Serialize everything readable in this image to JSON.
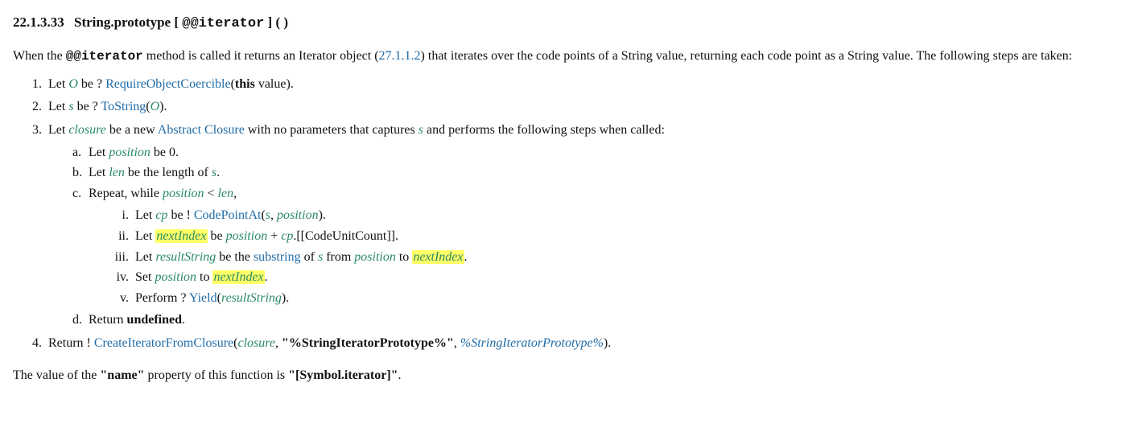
{
  "heading": {
    "number": "22.1.3.33",
    "title_prefix": "String.prototype [ ",
    "title_symbol": "@@iterator",
    "title_suffix": " ] ( )"
  },
  "intro": {
    "pre": "When the ",
    "method": "@@iterator",
    "mid": " method is called it returns an Iterator object (",
    "ref": "27.1.1.2",
    "post": ") that iterates over the code points of a String value, returning each code point as a String value. The following steps are taken:"
  },
  "steps": {
    "s1": {
      "marker": "1.",
      "text_a": "Let ",
      "O": "O",
      "text_b": " be ? ",
      "link": "RequireObjectCoercible",
      "paren_open": "(",
      "this": "this",
      "valueword": " value",
      "paren_close": ")."
    },
    "s2": {
      "marker": "2.",
      "text_a": "Let ",
      "s": "s",
      "text_b": " be ? ",
      "link": "ToString",
      "paren_open": "(",
      "O": "O",
      "paren_close": ")."
    },
    "s3": {
      "marker": "3.",
      "text_a": "Let ",
      "closure": "closure",
      "text_b": " be a new ",
      "link": "Abstract Closure",
      "text_c": " with no parameters that captures ",
      "s": "s",
      "text_d": " and performs the following steps when called:"
    },
    "s3a": {
      "marker": "a.",
      "text_a": "Let ",
      "position": "position",
      "text_b": " be 0."
    },
    "s3b": {
      "marker": "b.",
      "text_a": "Let ",
      "len": "len",
      "text_b": " be the length of ",
      "s": "s",
      "text_c": "."
    },
    "s3c": {
      "marker": "c.",
      "text_a": "Repeat, while ",
      "position": "position",
      "lt": " < ",
      "len": "len",
      "comma": ","
    },
    "s3ci": {
      "marker": "i.",
      "text_a": "Let ",
      "cp": "cp",
      "text_b": " be ! ",
      "link": "CodePointAt",
      "paren_open": "(",
      "s": "s",
      "comma": ", ",
      "position": "position",
      "paren_close": ")."
    },
    "s3cii": {
      "marker": "ii.",
      "text_a": "Let ",
      "nextIndex": "nextIndex",
      "text_b": " be ",
      "position": "position",
      "plus": " + ",
      "cp": "cp",
      "field": ".[[CodeUnitCount]]."
    },
    "s3ciii": {
      "marker": "iii.",
      "text_a": "Let ",
      "resultString": "resultString",
      "text_b": " be the ",
      "link": "substring",
      "text_c": " of ",
      "s": "s",
      "text_d": " from ",
      "position": "position",
      "text_e": " to ",
      "nextIndex": "nextIndex",
      "period": "."
    },
    "s3civ": {
      "marker": "iv.",
      "text_a": "Set ",
      "position": "position",
      "text_b": " to ",
      "nextIndex": "nextIndex",
      "period": "."
    },
    "s3cv": {
      "marker": "v.",
      "text_a": "Perform ? ",
      "link": "Yield",
      "paren_open": "(",
      "resultString": "resultString",
      "paren_close": ")."
    },
    "s3d": {
      "marker": "d.",
      "text_a": "Return ",
      "undefined": "undefined",
      "period": "."
    },
    "s4": {
      "marker": "4.",
      "text_a": "Return ! ",
      "link": "CreateIteratorFromClosure",
      "paren_open": "(",
      "closure": "closure",
      "comma1": ", ",
      "str": "\"%StringIteratorPrototype%\"",
      "comma2": ", ",
      "pct": "%StringIteratorPrototype%",
      "paren_close": ")."
    }
  },
  "footer": {
    "pre": "The value of the ",
    "name": "\"name\"",
    "mid": " property of this function is ",
    "value": "\"[Symbol.iterator]\"",
    "period": "."
  }
}
